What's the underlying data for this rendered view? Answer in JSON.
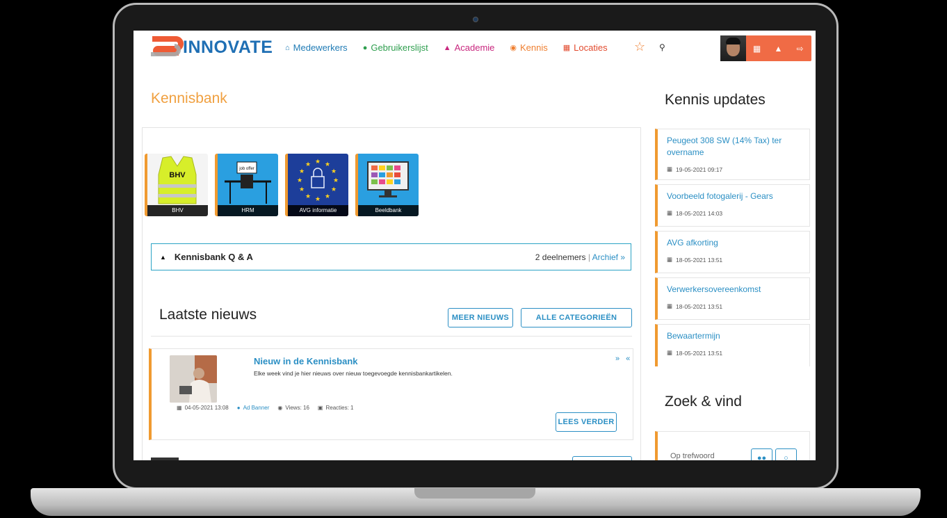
{
  "brand": {
    "name": "INNOVATE",
    "accent": "#f09a30",
    "primary": "#2b8fc4",
    "orange": "#f06b45"
  },
  "nav": [
    {
      "label": "Medewerkers",
      "icon": "home-icon",
      "color": "#1f7bb5"
    },
    {
      "label": "Gebruikerslijst",
      "icon": "person-icon",
      "color": "#2e9e4e"
    },
    {
      "label": "Academie",
      "icon": "graduation-cap-icon",
      "color": "#c8267e"
    },
    {
      "label": "Kennis",
      "icon": "lightbulb-icon",
      "color": "#ef7f30"
    },
    {
      "label": "Locaties",
      "icon": "map-icon",
      "color": "#e24a2e"
    }
  ],
  "page": {
    "title": "Kennisbank"
  },
  "tiles": [
    {
      "label": "BHV",
      "img_text": "BHV"
    },
    {
      "label": "HRM",
      "img_text": "job offer"
    },
    {
      "label": "AVG informatie"
    },
    {
      "label": "Beeldbank"
    }
  ],
  "qa": {
    "title": "Kennisbank Q & A",
    "participants": "2 deelnemers",
    "separator": "|",
    "archive": "Archief »"
  },
  "news": {
    "title": "Laatste nieuws",
    "more_button": "MEER NIEUWS",
    "categories_button": "ALLE CATEGORIEËN",
    "items": [
      {
        "title": "Nieuw in de Kennisbank",
        "body": "Elke week vind je hier nieuws over nieuw toegevoegde kennisbankartikelen.",
        "date": "04-05-2021 13:08",
        "author": "Ad Banner",
        "views": "Views: 16",
        "comments": "Reacties: 1",
        "read_more": "LEES VERDER",
        "arrows": "» «"
      }
    ]
  },
  "sidebar": {
    "updates_title": "Kennis updates",
    "updates": [
      {
        "title": "Peugeot 308 SW (14% Tax) ter overname",
        "date": "19-05-2021 09:17"
      },
      {
        "title": "Voorbeeld fotogalerij - Gears",
        "date": "18-05-2021 14:03"
      },
      {
        "title": "AVG afkorting",
        "date": "18-05-2021 13:51"
      },
      {
        "title": "Verwerkersovereenkomst",
        "date": "18-05-2021 13:51"
      },
      {
        "title": "Bewaartermijn",
        "date": "18-05-2021 13:51"
      }
    ],
    "search_title": "Zoek & vind",
    "search_label": "Op trefwoord"
  }
}
